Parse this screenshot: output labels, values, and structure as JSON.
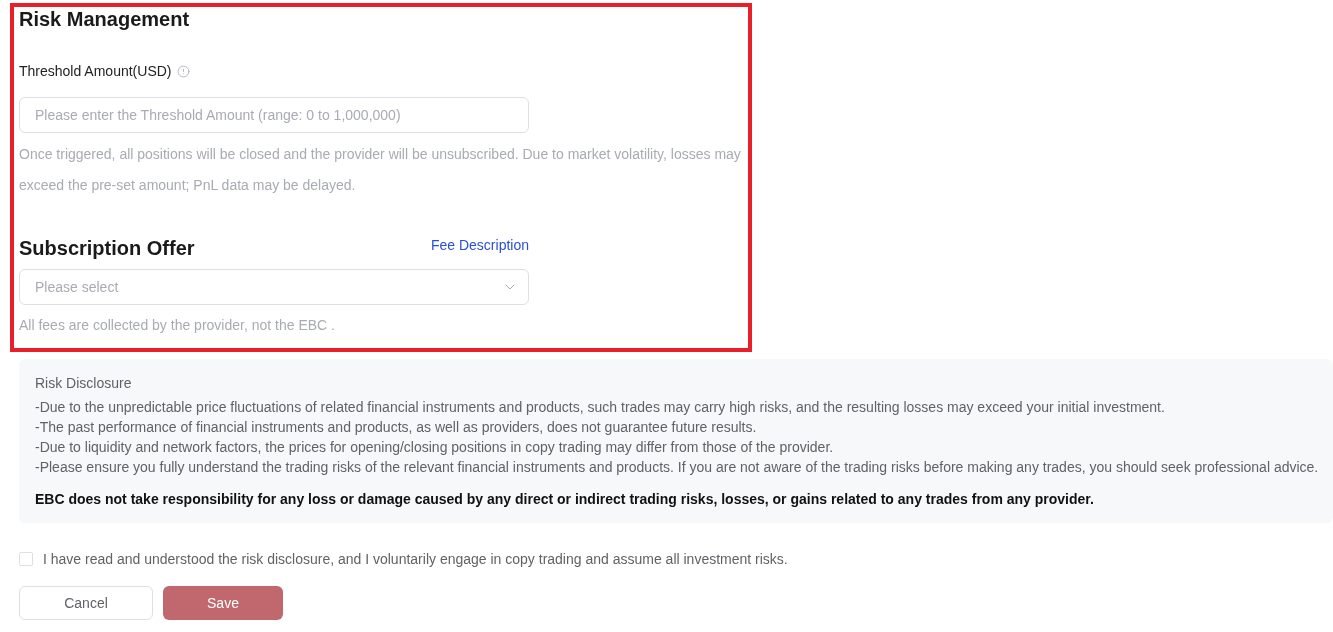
{
  "form": {
    "highlighted": true,
    "risk_management": {
      "title": "Risk Management",
      "threshold": {
        "label": "Threshold Amount(USD)",
        "placeholder": "Please enter the Threshold Amount (range: 0 to 1,000,000)",
        "help": "Once triggered, all positions will be closed and the provider will be unsubscribed. Due to market volatility, losses may exceed the pre-set amount; PnL data may be delayed."
      }
    },
    "subscription_offer": {
      "title": "Subscription Offer",
      "link": "Fee Description",
      "select": {
        "placeholder": "Please select"
      },
      "note": "All fees are collected by the provider, not the EBC ."
    }
  },
  "risk_disclosure": {
    "title": "Risk Disclosure",
    "lines": [
      "-Due to the unpredictable price fluctuations of related financial instruments and products, such trades may carry high risks, and the resulting losses may exceed your initial investment.",
      "-The past performance of financial instruments and products, as well as providers, does not guarantee future results.",
      "-Due to liquidity and network factors, the prices for opening/closing positions in copy trading may differ from those of the provider.",
      "-Please ensure you fully understand the trading risks of the relevant financial instruments and products. If you are not aware of the trading risks before making any trades, you should seek professional advice."
    ],
    "statement": "EBC does not take responsibility for any loss or damage caused by any direct or indirect trading risks, losses, or gains related to any trades from any provider."
  },
  "agreement": {
    "checked": false,
    "label": "I have read and understood the risk disclosure, and I voluntarily engage in copy trading and assume all investment risks."
  },
  "buttons": [
    {
      "kind": "secondary",
      "label": "Cancel",
      "disabled": false
    },
    {
      "kind": "primary",
      "label": "Save",
      "disabled": true
    }
  ]
}
